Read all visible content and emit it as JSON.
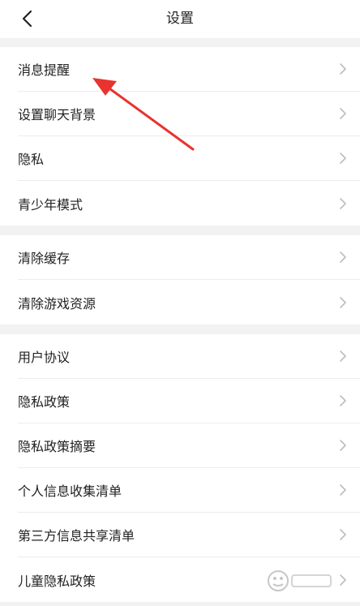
{
  "header": {
    "title": "设置"
  },
  "groups": [
    {
      "items": [
        {
          "label": "消息提醒"
        },
        {
          "label": "设置聊天背景"
        },
        {
          "label": "隐私"
        },
        {
          "label": "青少年模式"
        }
      ]
    },
    {
      "items": [
        {
          "label": "清除缓存"
        },
        {
          "label": "清除游戏资源"
        }
      ]
    },
    {
      "items": [
        {
          "label": "用户协议"
        },
        {
          "label": "隐私政策"
        },
        {
          "label": "隐私政策摘要"
        },
        {
          "label": "个人信息收集清单"
        },
        {
          "label": "第三方信息共享清单"
        },
        {
          "label": "儿童隐私政策"
        }
      ]
    }
  ],
  "colors": {
    "background": "#f2f2f2",
    "card": "#ffffff",
    "text": "#222222",
    "chevron": "#bdbdbd",
    "annotation_arrow": "#e8332e"
  },
  "icons": {
    "back": "chevron-left-icon",
    "row_arrow": "chevron-right-icon"
  }
}
